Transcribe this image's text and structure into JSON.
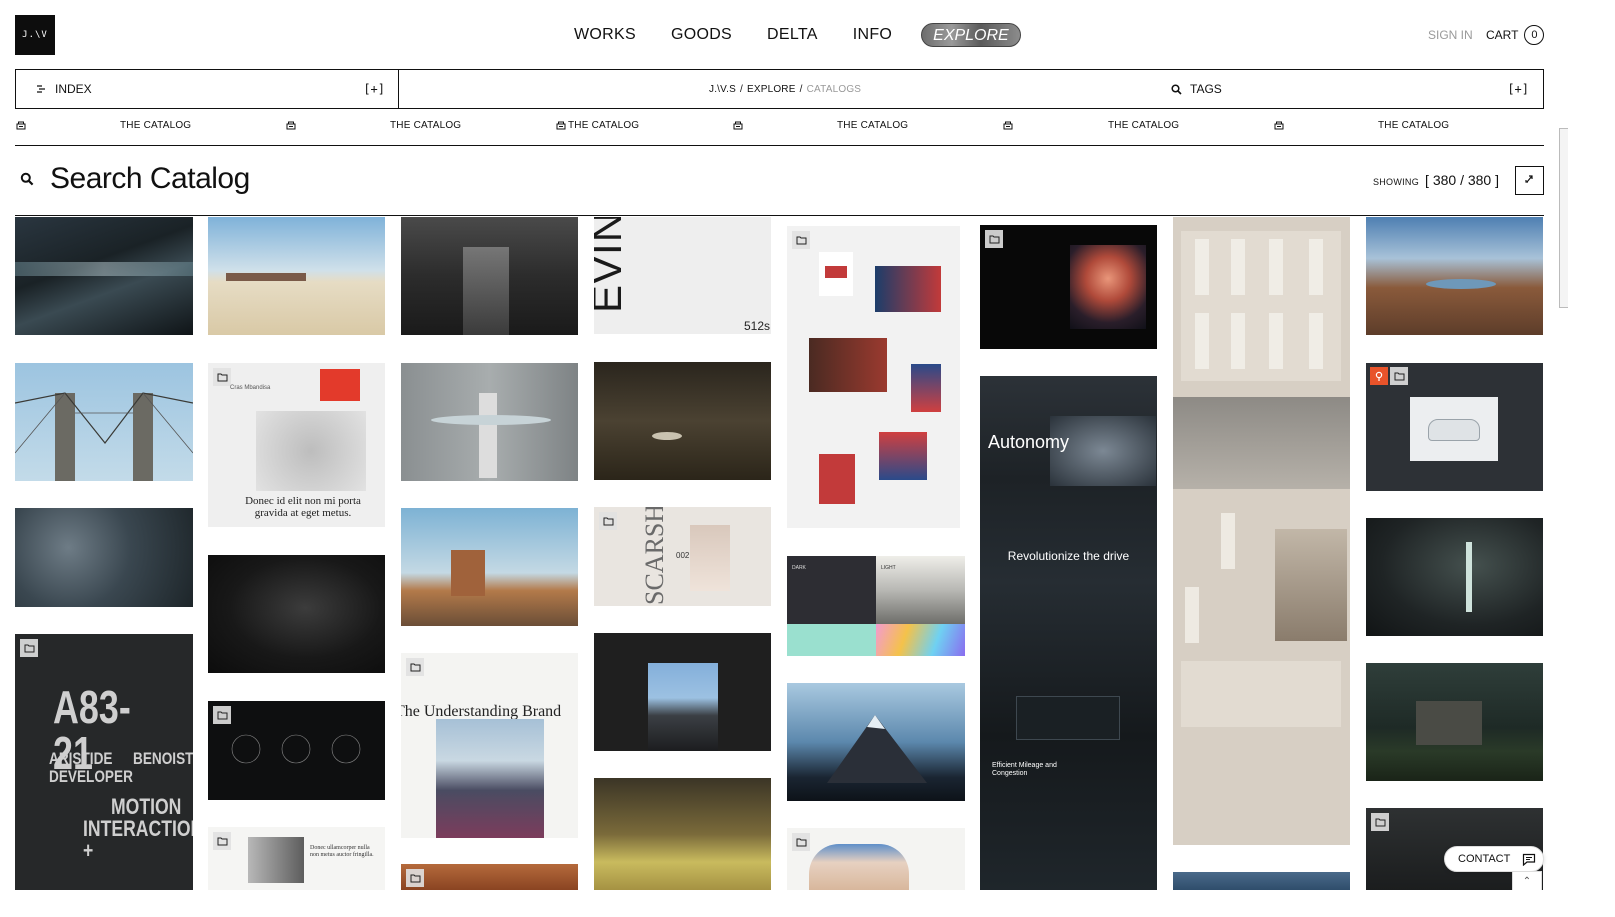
{
  "brand": {
    "logo_text": "J.\\V"
  },
  "nav": {
    "items": [
      "WORKS",
      "GOODS",
      "DELTA",
      "INFO"
    ],
    "explore": "EXPLORE",
    "signin": "SIGN IN",
    "cart": "CART",
    "cart_count": "0"
  },
  "index_bar": {
    "index_label": "INDEX",
    "plus": "[+]",
    "crumb_home": "J.\\V.S",
    "crumb_sep": "/",
    "crumb_explore": "EXPLORE",
    "crumb_current": "CATALOGS",
    "tags_label": "TAGS"
  },
  "marquee": {
    "label": "THE CATALOG"
  },
  "search": {
    "title": "Search Catalog",
    "showing_label": "SHOWING",
    "count": "[ 380 / 380 ]"
  },
  "tiles_text": {
    "evine": "EVINE",
    "evine_num": "512s",
    "don_title": "Donec id elit non mi porta gravida at eget metus.",
    "don_name": "Cras Mbandisa",
    "autonomy": "Autonomy",
    "revolutionize": "Revolutionize the drive",
    "efficient": "Efficient Mileage and Congestion",
    "understanding": "The Understanding Brand",
    "scarsho": "SCARSHO",
    "scarsho_num": "002",
    "a321_line1": "A83-21",
    "a321_line2": "ARISTIDE",
    "a321_line3": "BENOIST",
    "a321_line4": "DEVELOPER",
    "a321_line5": "MOTION",
    "a321_line6": "INTERACTION +",
    "dark": "DARK",
    "light": "LIGHT",
    "donec_small": "Donec ullamcorper nulla non metus auctor fringilla."
  },
  "contact": {
    "label": "CONTACT"
  },
  "colors": {
    "accent_orange": "#e8532a",
    "ink": "#111111"
  }
}
